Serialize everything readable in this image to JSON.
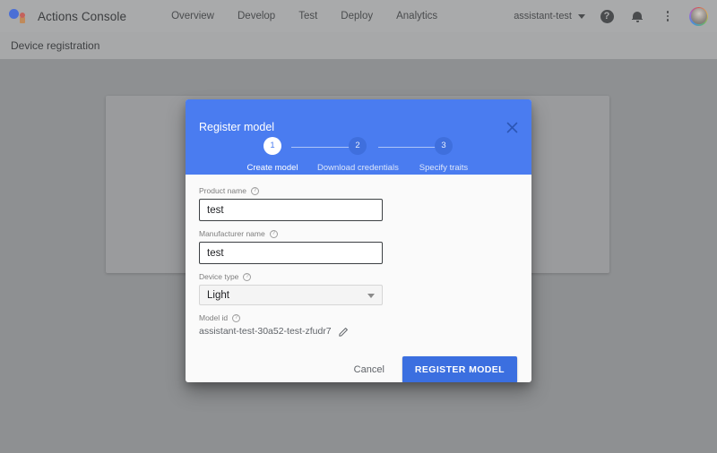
{
  "appbar": {
    "logo_icon": "google-actions-logo-icon",
    "brand_title": "Actions Console",
    "nav_items": [
      {
        "label": "Overview"
      },
      {
        "label": "Develop"
      },
      {
        "label": "Test"
      },
      {
        "label": "Deploy"
      },
      {
        "label": "Analytics"
      }
    ],
    "account_name": "assistant-test",
    "help_glyph": "?",
    "icons": {
      "help": "help-circle-icon",
      "notifications": "bell-icon",
      "overflow": "kebab-menu-icon",
      "avatar": "user-avatar"
    }
  },
  "subheader": {
    "title": "Device registration"
  },
  "dialog": {
    "title": "Register model",
    "close_label": "×",
    "stepper": [
      {
        "number": "1",
        "label": "Create model",
        "state": "active"
      },
      {
        "number": "2",
        "label": "Download credentials",
        "state": "inactive"
      },
      {
        "number": "3",
        "label": "Specify traits",
        "state": "inactive"
      }
    ],
    "help_glyph": "?",
    "fields": {
      "product_name": {
        "label": "Product name",
        "value": "test",
        "placeholder": ""
      },
      "manufacturer_name": {
        "label": "Manufacturer name",
        "value": "test",
        "placeholder": ""
      },
      "device_type": {
        "label": "Device type",
        "value": "Light",
        "options": [
          "Light"
        ]
      },
      "model_id": {
        "label": "Model id",
        "value": "assistant-test-30a52-test-zfudr7",
        "edit_icon": "pencil-icon"
      }
    },
    "footer": {
      "cancel_label": "Cancel",
      "submit_label": "REGISTER MODEL"
    }
  },
  "colors": {
    "dialog_header_blue": "#4a7cf0",
    "primary_button_blue": "#3b6fe0",
    "page_dim_gray": "#8e9092",
    "appbar_gray": "#a9aaab"
  }
}
